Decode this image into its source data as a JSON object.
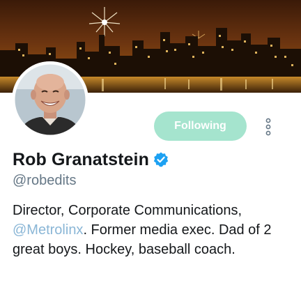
{
  "profile": {
    "display_name": "Rob Granatstein",
    "handle": "@robedits",
    "verified": true,
    "bio": {
      "line_1": "Director, Corporate Communications,",
      "mention": "@Metrolinx",
      "line_2_rest": ". Former media exec. Dad of 2",
      "line_3": "great boys. Hockey, baseball coach."
    }
  },
  "actions": {
    "follow_label": "Following",
    "more_icon": "more-vertical-icon"
  },
  "colors": {
    "following_button_bg": "#a5e4ce",
    "following_button_text": "#ffffff",
    "mention": "#8ab6d6",
    "handle": "#657786",
    "verified_badge": "#1da1f2",
    "more_icon": "#657786"
  },
  "images": {
    "banner": "city-skyline-fireworks-night",
    "avatar": "bald-smiling-man-portrait"
  }
}
